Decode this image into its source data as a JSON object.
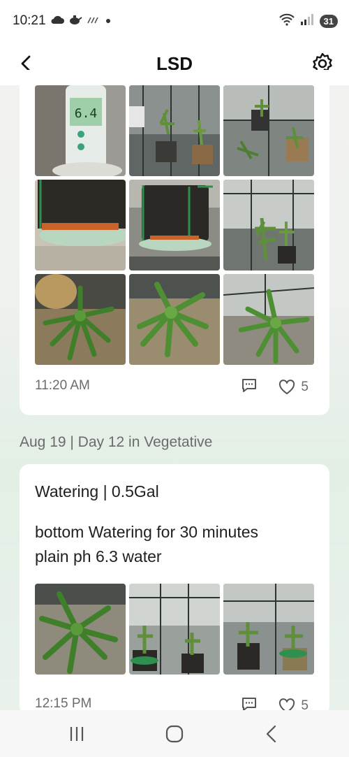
{
  "status_bar": {
    "time": "10:21",
    "battery": "31",
    "icons": [
      "cloud-icon",
      "teapot-icon",
      "no-signal-icon",
      "dot-icon",
      "wifi-icon",
      "cell-signal-icon"
    ]
  },
  "header": {
    "title": "LSD"
  },
  "entries": [
    {
      "time": "11:20 AM",
      "likes": "5",
      "photos": [
        "ph-meter-reading",
        "greenhouse-plants",
        "greenhouse-pots",
        "fabric-pot-saucer",
        "fabric-pot-side",
        "greenhouse-plant-pot",
        "plant-topdown",
        "plant-closeup",
        "plant-leaves"
      ]
    },
    {
      "date_header": "Aug 19 | Day 12 in Vegetative",
      "title": "Watering | 0.5Gal",
      "note_line1": "bottom Watering for 30 minutes",
      "note_line2": "plain ph 6.3 water",
      "time": "12:15 PM",
      "likes": "5",
      "photos": [
        "plant-closeup",
        "greenhouse-row",
        "greenhouse-interior"
      ]
    }
  ],
  "colors": {
    "accent_green": "#2f8f4e",
    "muted_text": "#6b6b6b",
    "card": "#ffffff"
  }
}
